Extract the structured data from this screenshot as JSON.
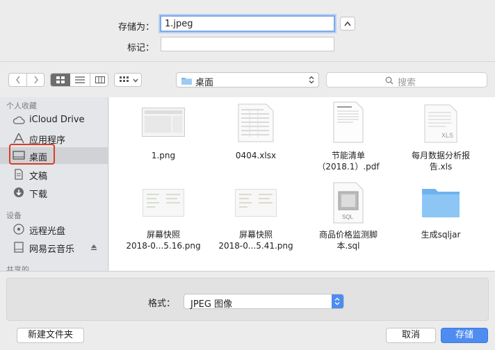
{
  "save": {
    "save_as_label": "存储为：",
    "save_as_value": "1.jpeg",
    "tags_label": "标记：",
    "tags_value": ""
  },
  "toolbar": {
    "location": "桌面",
    "search_placeholder": "搜索"
  },
  "sidebar": {
    "favorites_header": "个人收藏",
    "favorites": [
      {
        "label": "iCloud Drive",
        "icon": "cloud-icon"
      },
      {
        "label": "应用程序",
        "icon": "applications-icon"
      },
      {
        "label": "桌面",
        "icon": "desktop-icon",
        "selected": true
      },
      {
        "label": "文稿",
        "icon": "documents-icon"
      },
      {
        "label": "下载",
        "icon": "downloads-icon"
      }
    ],
    "devices_header": "设备",
    "devices": [
      {
        "label": "远程光盘",
        "icon": "disc-icon"
      },
      {
        "label": "网易云音乐",
        "icon": "drive-icon",
        "eject": true
      }
    ],
    "shared_header": "共享的"
  },
  "files": [
    {
      "name": "1.png",
      "kind": "png"
    },
    {
      "name": "0404.xlsx",
      "kind": "xlsx"
    },
    {
      "name": "节能清单（2018.1）.pdf",
      "line1": "节能清单",
      "line2": "（2018.1）.pdf",
      "kind": "pdf"
    },
    {
      "name": "每月数据分析报告.xls",
      "line1": "每月数据分析报",
      "line2": "告.xls",
      "kind": "xls"
    },
    {
      "name": "屏幕快照 2018-0...5.16.png",
      "line1": "屏幕快照",
      "line2": "2018-0...5.16.png",
      "kind": "screenshot"
    },
    {
      "name": "屏幕快照 2018-0...5.41.png",
      "line1": "屏幕快照",
      "line2": "2018-0...5.41.png",
      "kind": "screenshot"
    },
    {
      "name": "商品价格监测脚本.sql",
      "line1": "商品价格监测脚",
      "line2": "本.sql",
      "kind": "sql"
    },
    {
      "name": "生成sqljar",
      "kind": "folder"
    }
  ],
  "format": {
    "label": "格式：",
    "value": "JPEG 图像"
  },
  "buttons": {
    "new_folder": "新建文件夹",
    "cancel": "取消",
    "save": "存储"
  },
  "colors": {
    "accent": "#4f8cf0",
    "selection": "#d0d2d6",
    "annotation": "#d93c26"
  }
}
